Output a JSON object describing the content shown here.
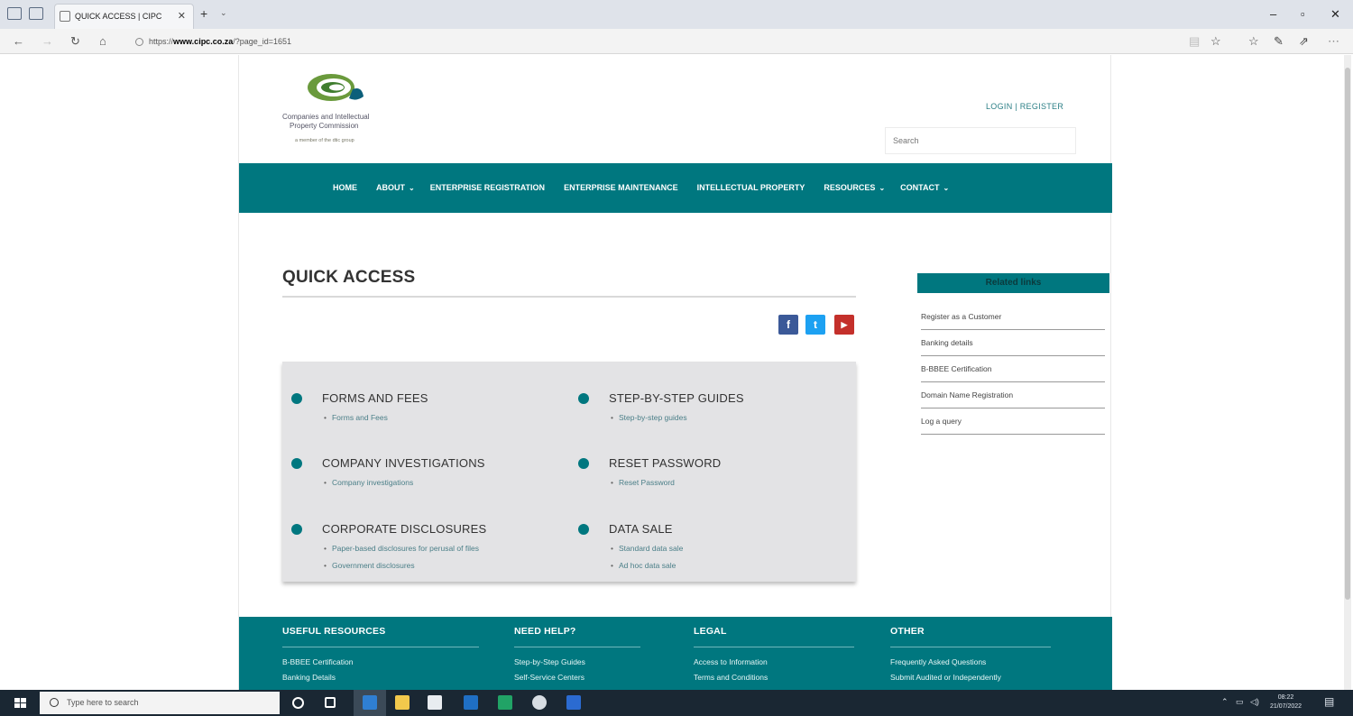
{
  "browser": {
    "tab_title": "QUICK ACCESS | CIPC",
    "url_prefix": "https://",
    "url_domain": "www.cipc.co.za",
    "url_path": "/?page_id=1651"
  },
  "header": {
    "logo_line1": "Companies and Intellectual",
    "logo_line2": "Property Commission",
    "logo_tag": "a member of the dtic group",
    "login_register": "LOGIN | REGISTER",
    "search_placeholder": "Search"
  },
  "nav": {
    "items": [
      {
        "label": "HOME",
        "caret": ""
      },
      {
        "label": "ABOUT",
        "caret": "⌄"
      },
      {
        "label": "ENTERPRISE REGISTRATION",
        "caret": ""
      },
      {
        "label": "ENTERPRISE MAINTENANCE",
        "caret": ""
      },
      {
        "label": "INTELLECTUAL PROPERTY",
        "caret": ""
      },
      {
        "label": "RESOURCES",
        "caret": "⌄"
      },
      {
        "label": "CONTACT",
        "caret": "⌄"
      }
    ]
  },
  "main": {
    "title": "QUICK ACCESS",
    "social": {
      "facebook": "f",
      "twitter": "t",
      "youtube": "▶"
    },
    "sections": [
      {
        "heading": "FORMS AND FEES",
        "links": [
          "Forms and Fees"
        ]
      },
      {
        "heading": "STEP-BY-STEP GUIDES",
        "links": [
          "Step-by-step guides"
        ]
      },
      {
        "heading": "COMPANY INVESTIGATIONS",
        "links": [
          "Company investigations"
        ]
      },
      {
        "heading": "RESET PASSWORD",
        "links": [
          "Reset Password"
        ]
      },
      {
        "heading": "CORPORATE DISCLOSURES",
        "links": [
          "Paper-based disclosures for perusal of files",
          "Government disclosures"
        ]
      },
      {
        "heading": "DATA SALE",
        "links": [
          "Standard data sale",
          "Ad hoc data sale"
        ]
      }
    ]
  },
  "related": {
    "heading": "Related links",
    "items": [
      "Register as a Customer",
      "Banking details",
      "B-BBEE Certification",
      "Domain Name Registration",
      "Log a query"
    ]
  },
  "footer": {
    "cols": [
      {
        "heading": "USEFUL RESOURCES",
        "links": [
          "B-BBEE Certification",
          "Banking Details"
        ]
      },
      {
        "heading": "NEED HELP?",
        "links": [
          "Step-by-Step Guides",
          "Self-Service Centers"
        ]
      },
      {
        "heading": "LEGAL",
        "links": [
          "Access to Information",
          "Terms and Conditions"
        ]
      },
      {
        "heading": "OTHER",
        "links": [
          "Frequently Asked Questions",
          "Submit Audited or Independently"
        ]
      }
    ]
  },
  "taskbar": {
    "search_placeholder": "Type here to search",
    "time": "08:22",
    "date": "21/07/2022"
  },
  "colors": {
    "teal": "#00777f",
    "facebook": "#3b5998",
    "twitter": "#1da1f2",
    "youtube": "#c4302b"
  }
}
